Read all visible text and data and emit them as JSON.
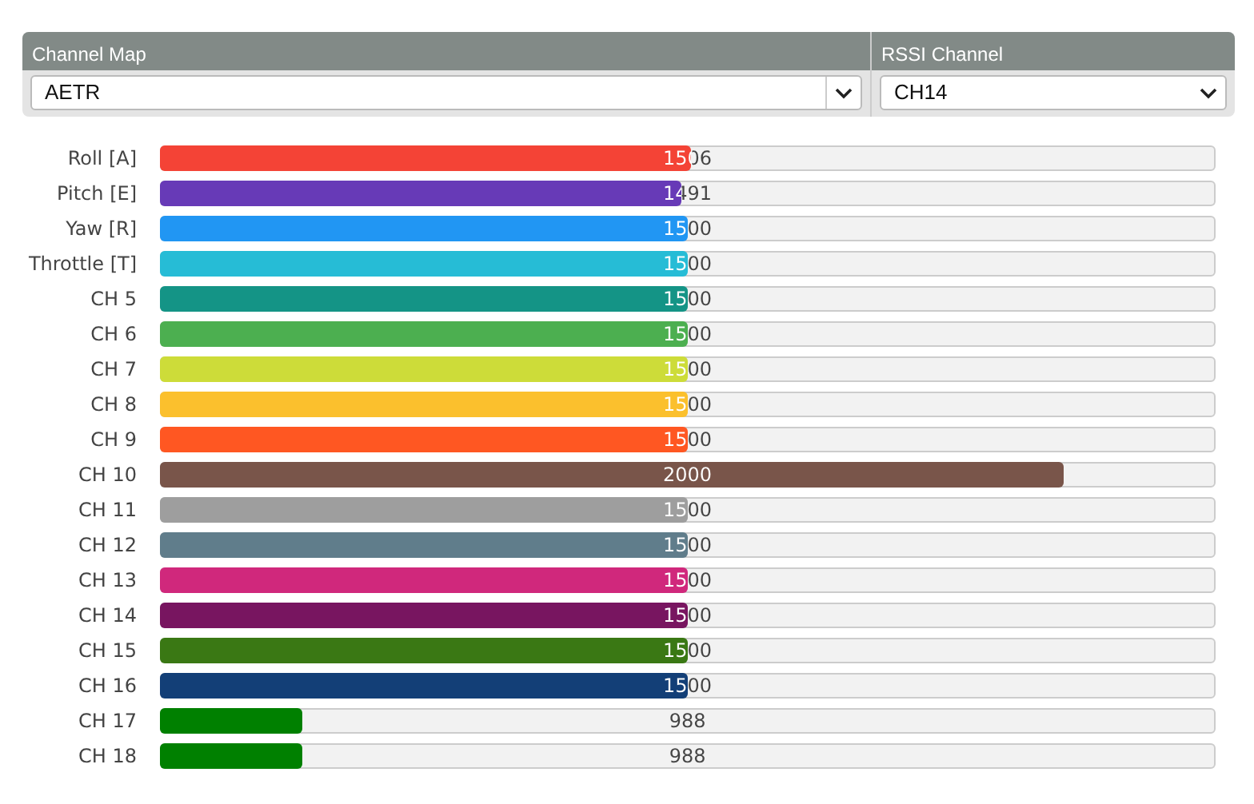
{
  "selectors": [
    {
      "title": "Channel Map",
      "value": "AETR",
      "kind": "combo"
    },
    {
      "title": "RSSI Channel",
      "value": "CH14",
      "kind": "select"
    }
  ],
  "channels": [
    {
      "name": "Roll [A]",
      "reading": "1506",
      "level": 0.504,
      "color": "#f44336"
    },
    {
      "name": "Pitch [E]",
      "reading": "1491",
      "level": 0.494,
      "color": "#673ab7"
    },
    {
      "name": "Yaw [R]",
      "reading": "1500",
      "level": 0.5,
      "color": "#2196f3"
    },
    {
      "name": "Throttle [T]",
      "reading": "1500",
      "level": 0.5,
      "color": "#26bcd6"
    },
    {
      "name": "CH 5",
      "reading": "1500",
      "level": 0.5,
      "color": "#149486"
    },
    {
      "name": "CH 6",
      "reading": "1500",
      "level": 0.5,
      "color": "#4caf50"
    },
    {
      "name": "CH 7",
      "reading": "1500",
      "level": 0.5,
      "color": "#cddc39"
    },
    {
      "name": "CH 8",
      "reading": "1500",
      "level": 0.5,
      "color": "#fbc02d"
    },
    {
      "name": "CH 9",
      "reading": "1500",
      "level": 0.5,
      "color": "#ff5722"
    },
    {
      "name": "CH 10",
      "reading": "2000",
      "level": 0.857,
      "color": "#79554a"
    },
    {
      "name": "CH 11",
      "reading": "1500",
      "level": 0.5,
      "color": "#9e9e9e"
    },
    {
      "name": "CH 12",
      "reading": "1500",
      "level": 0.5,
      "color": "#607d8b"
    },
    {
      "name": "CH 13",
      "reading": "1500",
      "level": 0.5,
      "color": "#d0287c"
    },
    {
      "name": "CH 14",
      "reading": "1500",
      "level": 0.5,
      "color": "#781560"
    },
    {
      "name": "CH 15",
      "reading": "1500",
      "level": 0.5,
      "color": "#3a7814"
    },
    {
      "name": "CH 16",
      "reading": "1500",
      "level": 0.5,
      "color": "#133f77"
    },
    {
      "name": "CH 17",
      "reading": "988",
      "level": 0.134,
      "color": "#008000"
    },
    {
      "name": "CH 18",
      "reading": "988",
      "level": 0.134,
      "color": "#008000"
    }
  ]
}
